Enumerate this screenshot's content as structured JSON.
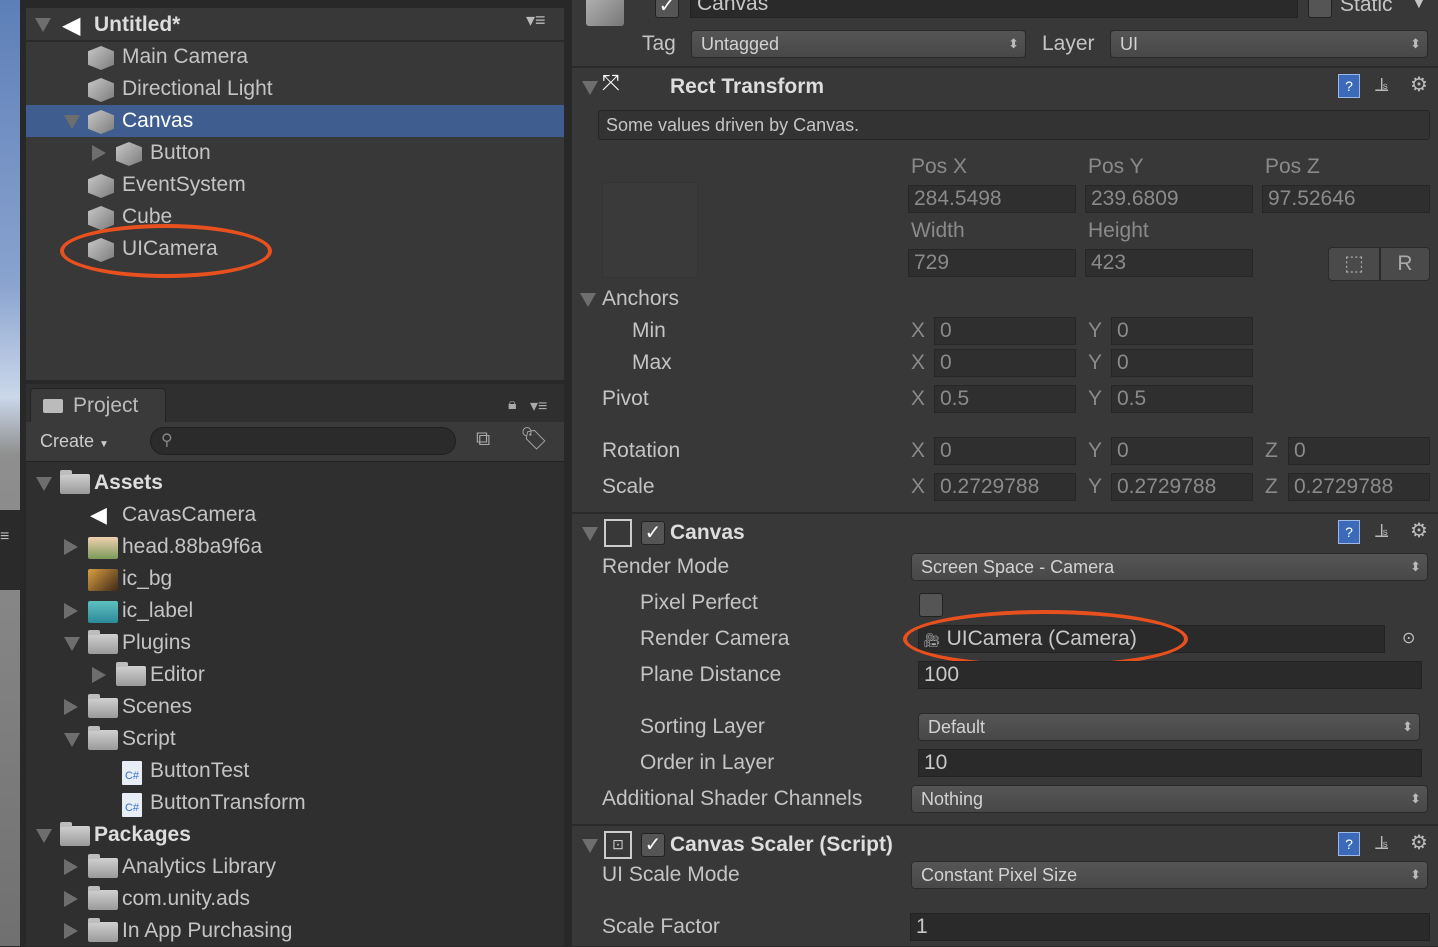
{
  "hierarchy": {
    "scene_title": "Untitled*",
    "menu_icon": "hamburger-menu-icon",
    "items": [
      {
        "label": "Main Camera",
        "depth": 1,
        "expanded": null,
        "selected": false
      },
      {
        "label": "Directional Light",
        "depth": 1,
        "expanded": null,
        "selected": false
      },
      {
        "label": "Canvas",
        "depth": 1,
        "expanded": true,
        "selected": true
      },
      {
        "label": "Button",
        "depth": 2,
        "expanded": false,
        "selected": false
      },
      {
        "label": "EventSystem",
        "depth": 1,
        "expanded": null,
        "selected": false
      },
      {
        "label": "Cube",
        "depth": 1,
        "expanded": null,
        "selected": false
      },
      {
        "label": "UICamera",
        "depth": 1,
        "expanded": null,
        "selected": false,
        "highlighted": true
      }
    ]
  },
  "project": {
    "tab_label": "Project",
    "create_label": "Create",
    "search_placeholder": "",
    "items": [
      {
        "label": "Assets",
        "depth": 0,
        "expanded": true,
        "icon": "folder",
        "bold": true
      },
      {
        "label": "CavasCamera",
        "depth": 1,
        "expanded": null,
        "icon": "unity-scene"
      },
      {
        "label": "head.88ba9f6a",
        "depth": 1,
        "expanded": false,
        "icon": "image-head"
      },
      {
        "label": "ic_bg",
        "depth": 1,
        "expanded": null,
        "icon": "image-bg"
      },
      {
        "label": "ic_label",
        "depth": 1,
        "expanded": false,
        "icon": "image-label"
      },
      {
        "label": "Plugins",
        "depth": 1,
        "expanded": true,
        "icon": "folder"
      },
      {
        "label": "Editor",
        "depth": 2,
        "expanded": false,
        "icon": "folder"
      },
      {
        "label": "Scenes",
        "depth": 1,
        "expanded": false,
        "icon": "folder"
      },
      {
        "label": "Script",
        "depth": 1,
        "expanded": true,
        "icon": "folder"
      },
      {
        "label": "ButtonTest",
        "depth": 2,
        "expanded": null,
        "icon": "csharp",
        "icon_text": "C#"
      },
      {
        "label": "ButtonTransform",
        "depth": 2,
        "expanded": null,
        "icon": "csharp",
        "icon_text": "C#"
      },
      {
        "label": "Packages",
        "depth": 0,
        "expanded": true,
        "icon": "folder",
        "bold": true
      },
      {
        "label": "Analytics Library",
        "depth": 1,
        "expanded": false,
        "icon": "folder"
      },
      {
        "label": "com.unity.ads",
        "depth": 1,
        "expanded": false,
        "icon": "folder"
      },
      {
        "label": "In App Purchasing",
        "depth": 1,
        "expanded": false,
        "icon": "folder"
      }
    ]
  },
  "inspector": {
    "object_name": "Canvas",
    "active": true,
    "static_label": "Static",
    "static": false,
    "tag_label": "Tag",
    "tag_value": "Untagged",
    "layer_label": "Layer",
    "layer_value": "UI",
    "rect_transform": {
      "title": "Rect Transform",
      "help": "Some values driven by Canvas.",
      "pos_x_label": "Pos X",
      "pos_y_label": "Pos Y",
      "pos_z_label": "Pos Z",
      "pos_x": "284.5498",
      "pos_y": "239.6809",
      "pos_z": "97.52646",
      "width_label": "Width",
      "height_label": "Height",
      "width": "729",
      "height": "423",
      "raw_button": "R",
      "anchors_label": "Anchors",
      "min_label": "Min",
      "max_label": "Max",
      "x": "X",
      "y": "Y",
      "z": "Z",
      "min_x": "0",
      "min_y": "0",
      "max_x": "0",
      "max_y": "0",
      "pivot_label": "Pivot",
      "pivot_x": "0.5",
      "pivot_y": "0.5",
      "rotation_label": "Rotation",
      "rot_x": "0",
      "rot_y": "0",
      "rot_z": "0",
      "scale_label": "Scale",
      "scale_x": "0.2729788",
      "scale_y": "0.2729788",
      "scale_z": "0.2729788"
    },
    "canvas": {
      "title": "Canvas",
      "enabled": true,
      "render_mode_label": "Render Mode",
      "render_mode": "Screen Space - Camera",
      "pixel_perfect_label": "Pixel Perfect",
      "pixel_perfect": false,
      "render_camera_label": "Render Camera",
      "render_camera": "UICamera (Camera)",
      "plane_distance_label": "Plane Distance",
      "plane_distance": "100",
      "sorting_layer_label": "Sorting Layer",
      "sorting_layer": "Default",
      "order_label": "Order in Layer",
      "order": "10",
      "shader_channels_label": "Additional Shader Channels",
      "shader_channels": "Nothing"
    },
    "canvas_scaler": {
      "title": "Canvas Scaler (Script)",
      "enabled": true,
      "scale_mode_label": "UI Scale Mode",
      "scale_mode": "Constant Pixel Size",
      "scale_factor_label": "Scale Factor",
      "scale_factor": "1"
    }
  },
  "colors": {
    "selection": "#3f5e8f",
    "highlight_ellipse": "#e8501e",
    "panel": "#383838"
  }
}
